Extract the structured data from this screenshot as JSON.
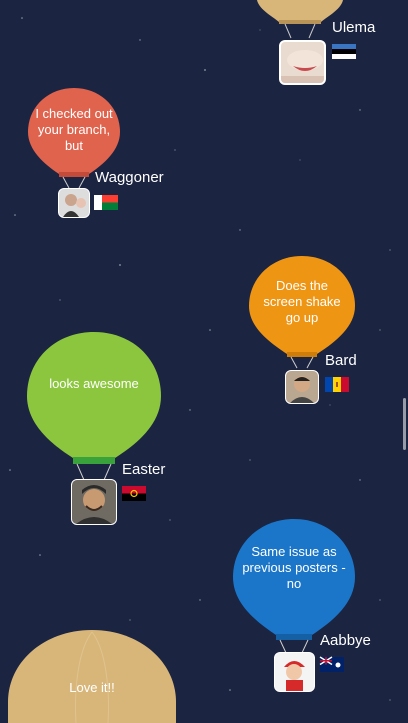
{
  "colors": {
    "background": "#1b2440",
    "tan": "#d8b67a",
    "red": "#e0634e",
    "orange": "#ef9514",
    "green": "#8cc63f",
    "blue": "#1b76c9"
  },
  "balloons": [
    {
      "user": "Ulema",
      "message": "",
      "color": "tan",
      "flag": "estonia-flag"
    },
    {
      "user": "Waggoner",
      "message": "I checked out your branch, but",
      "color": "red",
      "flag": "madagascar-flag"
    },
    {
      "user": "Bard",
      "message": "Does the screen shake go up",
      "color": "orange",
      "flag": "moldova-flag"
    },
    {
      "user": "Easter",
      "message": "looks awesome",
      "color": "green",
      "flag": "angola-flag"
    },
    {
      "user": "Aabbye",
      "message": "Same issue as previous posters - no",
      "color": "blue",
      "flag": "anguilla-flag"
    },
    {
      "user": "",
      "message": "Love it!!",
      "color": "tan",
      "flag": ""
    }
  ]
}
